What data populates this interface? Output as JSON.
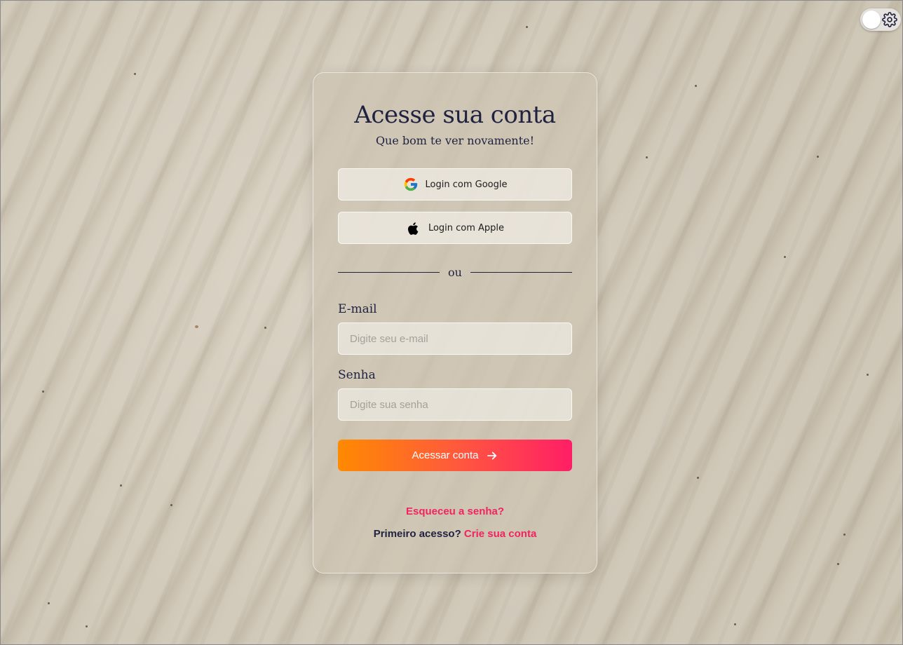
{
  "login": {
    "title": "Acesse sua conta",
    "subtitle": "Que bom te ver novamente!",
    "google_button": "Login com Google",
    "apple_button": "Login com Apple",
    "divider_text": "ou",
    "email_label": "E-mail",
    "email_placeholder": "Digite seu e-mail",
    "email_value": "",
    "password_label": "Senha",
    "password_placeholder": "Digite sua senha",
    "password_value": "",
    "submit_button": "Acessar conta",
    "forgot_password": "Esqueceu a senha?",
    "first_access_text": "Primeiro acesso?",
    "create_account_link": "Crie sua conta"
  },
  "theme_toggle": {
    "icon": "gear-icon",
    "state": "light"
  },
  "icons": {
    "google": "google-icon",
    "apple": "apple-icon",
    "submit_arrow": "arrow-right-icon"
  },
  "colors": {
    "accent_pink": "#f0245f",
    "gradient_start": "#ff8a00",
    "gradient_end": "#ff1e66",
    "text_dark": "#1f2240"
  }
}
